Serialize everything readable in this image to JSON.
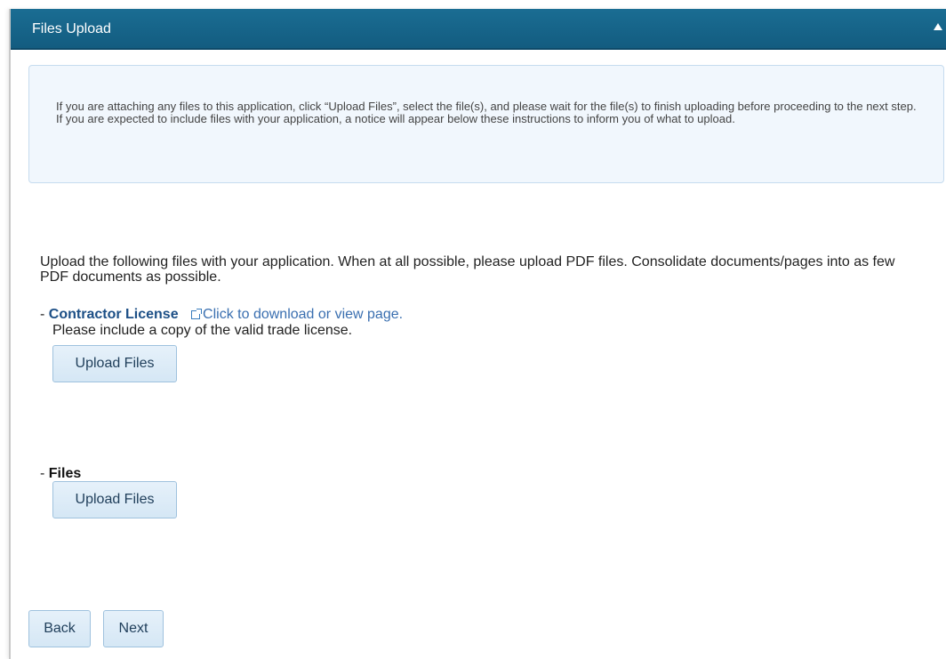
{
  "panel": {
    "title": "Files Upload"
  },
  "instructions": {
    "line1": "If you are attaching any files to this application, click “Upload Files”, select the file(s), and please wait for the file(s) to finish uploading before proceeding to the next step.",
    "line2": "If you are expected to include files with your application, a notice will appear below these instructions to inform you of what to upload."
  },
  "intro": "Upload the following files with your application. When at all possible, please upload PDF files. Consolidate documents/pages into as few PDF documents as possible.",
  "items": [
    {
      "prefix": "- ",
      "title": "Contractor License",
      "link_text": "Click to download or view page.",
      "note": "Please include a copy of the valid trade license.",
      "upload_label": "Upload Files"
    },
    {
      "prefix": "- ",
      "title": "Files",
      "upload_label": "Upload Files"
    }
  ],
  "nav": {
    "back_label": "Back",
    "next_label": "Next"
  },
  "colors": {
    "header_bg": "#135c80",
    "instructions_bg": "#f1f7fd",
    "item_title": "#1c4f86",
    "link": "#3a6fb0",
    "button_bg": "#d5e7f5"
  },
  "icons": {
    "collapse": "caret-up-icon",
    "external_link": "external-link-icon"
  }
}
